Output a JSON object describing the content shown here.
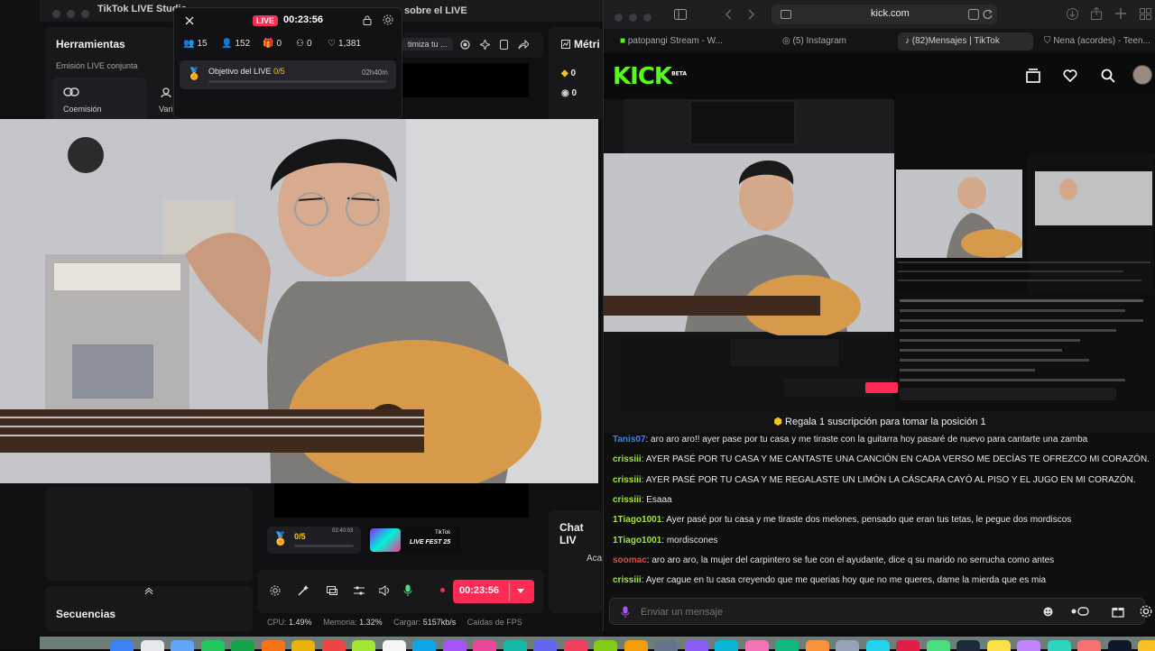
{
  "studio": {
    "title": "TikTok LIVE Studio",
    "banner_title": "sobre el LIVE",
    "tools_heading": "Herramientas",
    "collab_label": "Emisión LIVE conjunta",
    "tool_commission": "Coemisión",
    "tool_partial": "Vari",
    "metrics_partial": "Métri",
    "optimize_partial": "timiza tu ...",
    "sequences_label": "Secuencias",
    "chat_partial": "Chat LIV",
    "chat_partial2": "Aca",
    "metric_a": "0",
    "metric_b": "0"
  },
  "overlay": {
    "live_badge": "LIVE",
    "timer": "00:23:56",
    "stats": {
      "viewers": "15",
      "views": "152",
      "gifts": "0",
      "new_followers": "0",
      "likes": "1,381"
    },
    "goal_label": "Objetivo del LIVE",
    "goal_progress": "0/5",
    "goal_time": "02h40m"
  },
  "bottom": {
    "goal_count": "0/5",
    "goal_time": "02:40:03",
    "fest_label": "LIVE FEST 25",
    "fest_brand": "TikTok",
    "live_timer": "00:23:56",
    "cpu_label": "CPU:",
    "cpu_value": "1.49%",
    "mem_label": "Memoria:",
    "mem_value": "1.32%",
    "load_label": "Cargar:",
    "load_value": "5157kb/s",
    "drops_label": "Caídas de FPS"
  },
  "browser": {
    "url": "kick.com",
    "tabs": [
      {
        "label": "patopangi Stream - W..."
      },
      {
        "label": "(5) Instagram"
      },
      {
        "label": "(82)Mensajes | TikTok"
      },
      {
        "label": "Nena (acordes) - Teen..."
      }
    ],
    "logo": "KICK",
    "logo_beta": "BETA"
  },
  "chat": {
    "pinned": "Regala 1 suscripción para tomar la posición 1",
    "messages": [
      {
        "user": "Tanis07",
        "color": "#3b82f6",
        "text": ": aro aro aro!! ayer pase por tu casa y me tiraste con la guitarra hoy pasaré de nuevo para cantarte una zamba"
      },
      {
        "user": "crissiii",
        "color": "#a3e635",
        "text": ": AYER PASÉ POR TU CASA Y ME CANTASTE UNA CANCIÓN EN CADA VERSO ME DECÍAS TE OFREZCO MI CORAZÓN."
      },
      {
        "user": "crissiii",
        "color": "#a3e635",
        "text": ": AYER PASÉ POR TU CASA Y ME REGALASTE UN LIMÓN LA CÁSCARA CAYÓ AL PISO Y EL JUGO EN MI CORAZÓN."
      },
      {
        "user": "crissiii",
        "color": "#a3e635",
        "text": ": Esaaa"
      },
      {
        "user": "1Tiago1001",
        "color": "#a3e635",
        "text": ": Ayer pasé por tu casa y me tiraste dos melones, pensado que eran tus tetas, le pegue dos mordiscos"
      },
      {
        "user": "1Tiago1001",
        "color": "#a3e635",
        "text": ": mordiscones"
      },
      {
        "user": "soomac",
        "color": "#ef4444",
        "text": ": aro aro aro, la mujer del carpintero se fue con el ayudante, dice q su marido no serrucha como antes"
      },
      {
        "user": "crissiii",
        "color": "#a3e635",
        "text": ": Ayer cague en tu casa creyendo que me querias hoy que no me queres, dame la mierda que es mia"
      }
    ],
    "input_placeholder": "Enviar un mensaje"
  },
  "colors": {
    "tiktok_accent": "#fe2c55",
    "kick_green": "#53fc18"
  }
}
